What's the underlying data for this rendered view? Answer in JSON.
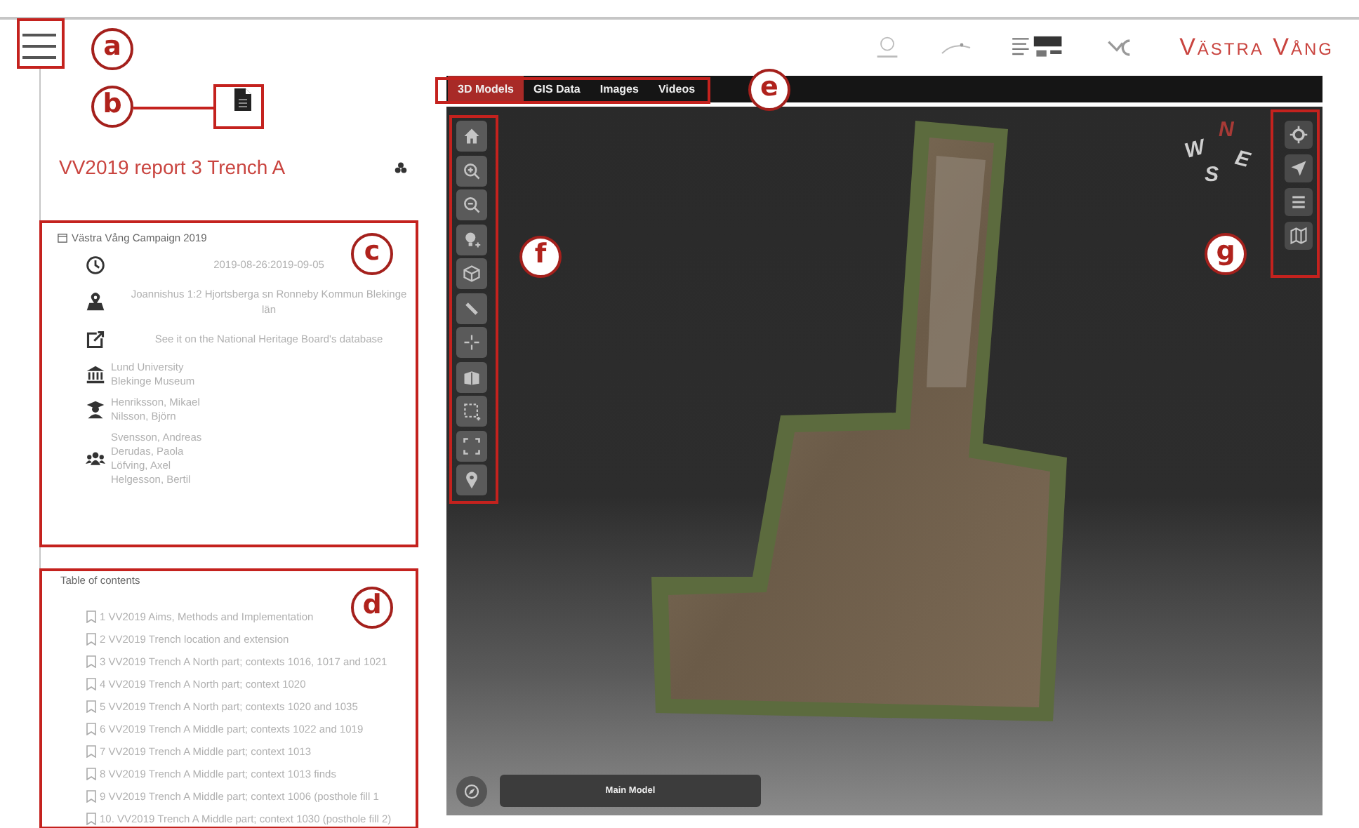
{
  "report": {
    "title": "VV2019 report 3 Trench A"
  },
  "campaign": {
    "title": "Västra Vång Campaign 2019",
    "rows": [
      {
        "kind": "single",
        "text": "2019-08-26:2019-09-05"
      },
      {
        "kind": "single",
        "text": "Joannishus 1:2 Hjortsberga sn Ronneby Kommun Blekinge län"
      },
      {
        "kind": "single",
        "text": "See it on the National Heritage Board's database"
      },
      {
        "kind": "names",
        "lines": [
          "Lund University",
          "Blekinge Museum"
        ]
      },
      {
        "kind": "names",
        "lines": [
          "Henriksson, Mikael",
          "Nilsson, Björn"
        ]
      },
      {
        "kind": "names",
        "lines": [
          "Svensson, Andreas",
          "Derudas, Paola",
          "Löfving, Axel",
          "Helgesson, Bertil"
        ]
      }
    ]
  },
  "toc": {
    "heading": "Table of contents",
    "items": [
      "1 VV2019 Aims, Methods and Implementation",
      "2 VV2019 Trench location and extension",
      "3 VV2019 Trench A North part; contexts 1016, 1017 and 1021",
      "4 VV2019 Trench A North part; context 1020",
      "5 VV2019 Trench A North part; contexts 1020 and 1035",
      "6 VV2019 Trench A Middle part; contexts 1022 and 1019",
      "7 VV2019 Trench A Middle part; context 1013",
      "8 VV2019 Trench A Middle part; context 1013 finds",
      "9 VV2019 Trench A Middle part; context 1006 (posthole fill 1",
      "10. VV2019 Trench A Middle part; context 1030 (posthole fill 2)"
    ]
  },
  "brand": {
    "name": "Västra Vång"
  },
  "tabs": [
    {
      "label": "3D Models",
      "selected": true
    },
    {
      "label": "GIS Data",
      "selected": false
    },
    {
      "label": "Images",
      "selected": false
    },
    {
      "label": "Videos",
      "selected": false
    }
  ],
  "compass": {
    "north": "N",
    "west": "W",
    "east": "E",
    "south": "S"
  },
  "model_bar": {
    "label": "Main Model"
  },
  "annotations": [
    {
      "label": "a",
      "kind": "plain"
    },
    {
      "label": "b",
      "kind": "leader"
    },
    {
      "label": "c",
      "kind": "plain"
    },
    {
      "label": "d",
      "kind": "plain"
    },
    {
      "label": "e",
      "kind": "plain"
    },
    {
      "label": "f",
      "kind": "plain"
    },
    {
      "label": "g",
      "kind": "plain"
    }
  ]
}
